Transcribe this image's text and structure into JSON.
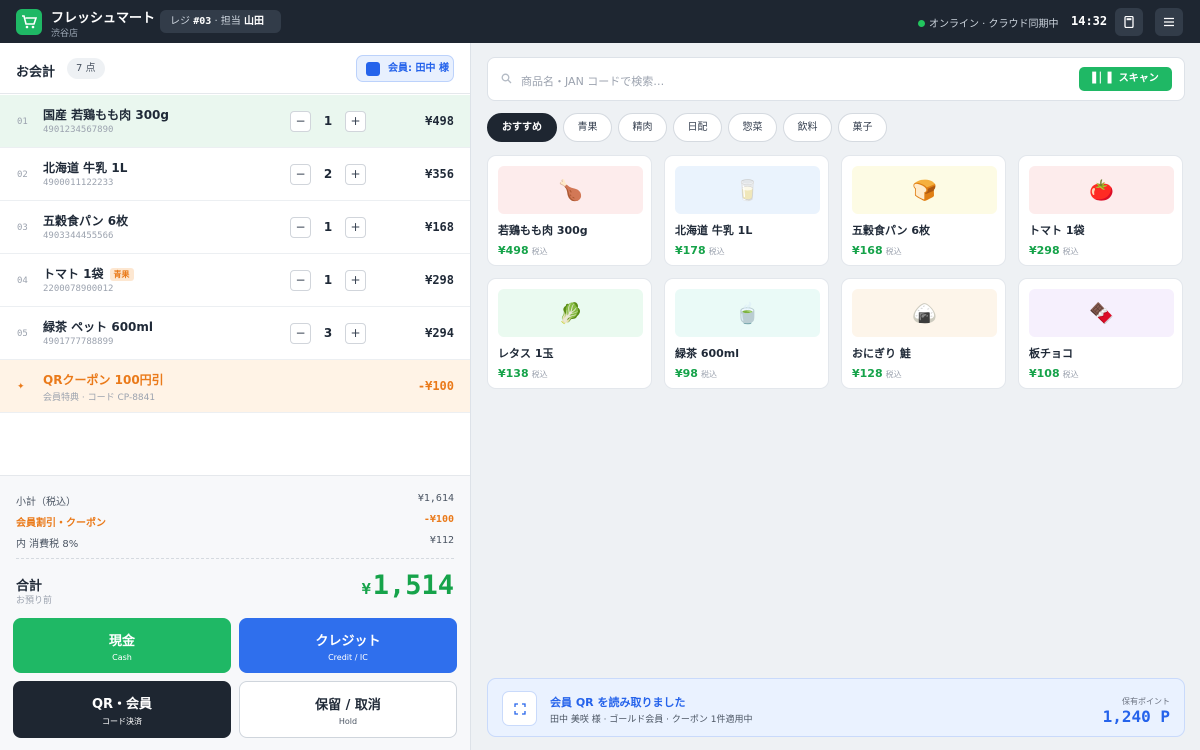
{
  "header": {
    "store_name": "フレッシュマート",
    "branch": "渋谷店",
    "register_label": "レジ",
    "register_no": "#03",
    "staff_label": "· 担当",
    "staff_name": "山田",
    "status": "オンライン · クラウド同期中",
    "time": "14:32",
    "icons": [
      "cart-logo-icon",
      "calculator-icon",
      "menu-icon"
    ],
    "status_color": "#22c55e"
  },
  "cart": {
    "title": "お会計",
    "count": "7 点",
    "member_button": "会員: 田中 様",
    "items": [
      {
        "no": "01",
        "name": "国産 若鶏もも肉 300g",
        "jan": "4901234567890",
        "qty": "1",
        "price": "¥498",
        "selected": true
      },
      {
        "no": "02",
        "name": "北海道 牛乳 1L",
        "jan": "4900011122233",
        "qty": "2",
        "price": "¥356"
      },
      {
        "no": "03",
        "name": "五穀食パン 6枚",
        "jan": "4903344455566",
        "qty": "1",
        "price": "¥168"
      },
      {
        "no": "04",
        "name": "トマト 1袋",
        "tag": "青果",
        "jan": "2200078900012",
        "qty": "1",
        "price": "¥298"
      },
      {
        "no": "05",
        "name": "緑茶 ペット 600ml",
        "jan": "4901777788899",
        "qty": "3",
        "price": "¥294"
      }
    ],
    "coupon": {
      "mark": "✦",
      "name": "QRクーポン 100円引",
      "sub": "会員特典 · コード CP-8841",
      "price": "-¥100"
    },
    "minus_label": "−",
    "plus_label": "+"
  },
  "totals": {
    "subtotal_label": "小計（税込）",
    "subtotal": "¥1,614",
    "discount_label": "会員割引・クーポン",
    "discount": "-¥100",
    "tax_label": "内 消費税 8%",
    "tax": "¥112",
    "total_label": "合計",
    "total_sub": "お預り前",
    "total_currency": "¥",
    "total": "1,514"
  },
  "payment": {
    "cash": {
      "label": "現金",
      "sub": "Cash"
    },
    "credit": {
      "label": "クレジット",
      "sub": "Credit / IC"
    },
    "qr": {
      "label": "QR・会員",
      "sub": "コード決済"
    },
    "hold": {
      "label": "保留 / 取消",
      "sub": "Hold"
    }
  },
  "search": {
    "placeholder": "商品名・JAN コードで検索…",
    "scan_label": "スキャン"
  },
  "categories": [
    "おすすめ",
    "青果",
    "精肉",
    "日配",
    "惣菜",
    "飲料",
    "菓子"
  ],
  "products": [
    {
      "name": "若鶏もも肉 300g",
      "price": "¥498",
      "tax": "税込",
      "emoji": "🍗",
      "bg": "#fdecec"
    },
    {
      "name": "北海道 牛乳 1L",
      "price": "¥178",
      "tax": "税込",
      "emoji": "🥛",
      "bg": "#eaf3fd"
    },
    {
      "name": "五穀食パン 6枚",
      "price": "¥168",
      "tax": "税込",
      "emoji": "🍞",
      "bg": "#fdfbe4"
    },
    {
      "name": "トマト 1袋",
      "price": "¥298",
      "tax": "税込",
      "emoji": "🍅",
      "bg": "#fdecec"
    },
    {
      "name": "レタス 1玉",
      "price": "¥138",
      "tax": "税込",
      "emoji": "🥬",
      "bg": "#eafaf0"
    },
    {
      "name": "緑茶 600ml",
      "price": "¥98",
      "tax": "税込",
      "emoji": "🍵",
      "bg": "#eafaf7"
    },
    {
      "name": "おにぎり 鮭",
      "price": "¥128",
      "tax": "税込",
      "emoji": "🍙",
      "bg": "#fdf5ea"
    },
    {
      "name": "板チョコ",
      "price": "¥108",
      "tax": "税込",
      "emoji": "🍫",
      "bg": "#f6f0fd"
    }
  ],
  "banner": {
    "title": "会員 QR を読み取りました",
    "sub": "田中 美咲 様 · ゴールド会員 · クーポン 1件適用中",
    "points_label": "保有ポイント",
    "points": "1,240 P"
  },
  "colors": {
    "accent_green": "#1fb865",
    "accent_blue": "#2f6fed",
    "dark": "#1e2631",
    "discount_orange": "#ea7a1a"
  }
}
